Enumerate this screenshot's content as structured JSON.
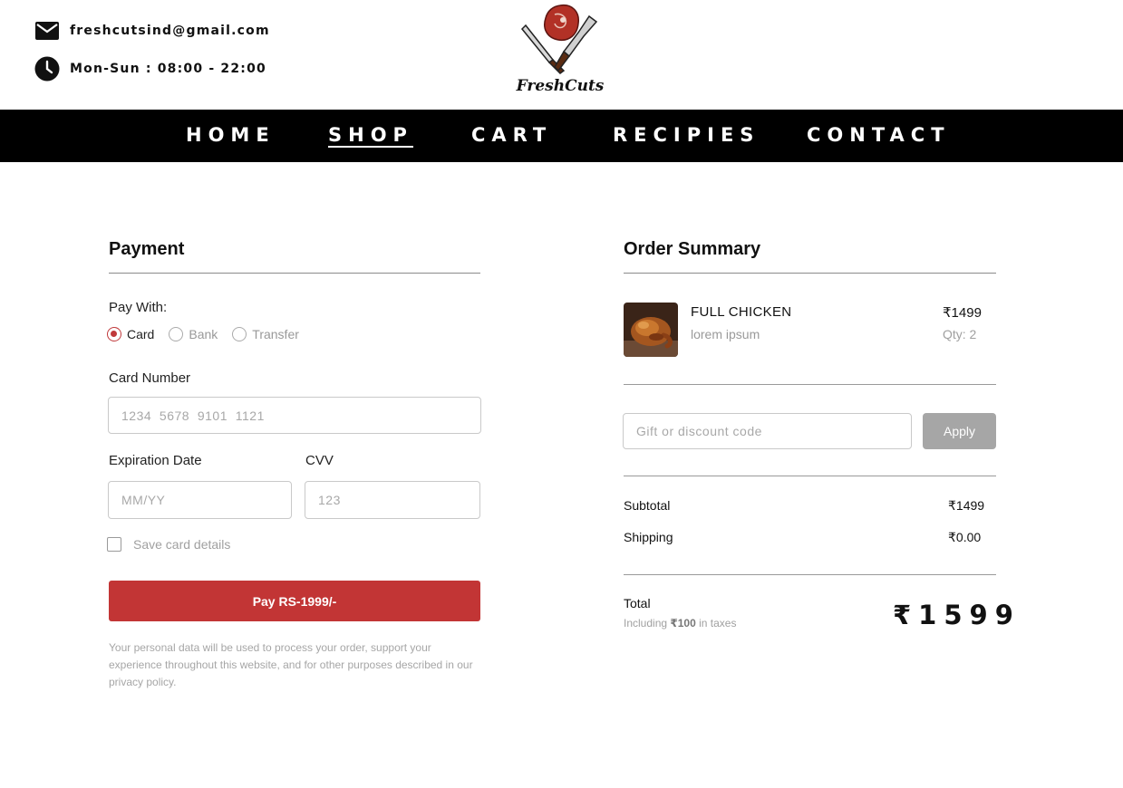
{
  "header": {
    "email": "freshcutsind@gmail.com",
    "hours": "Mon-Sun : 08:00 - 22:00",
    "logo_text": "FreshCuts",
    "icons": {
      "email": "mail-icon",
      "hours": "clock-icon"
    }
  },
  "nav": {
    "items": [
      {
        "label": "HOME"
      },
      {
        "label": "SHOP",
        "active": true
      },
      {
        "label": "CART"
      },
      {
        "label": "RECIPIES"
      },
      {
        "label": "CONTACT"
      }
    ]
  },
  "payment": {
    "title": "Payment",
    "pay_with_label": "Pay With:",
    "methods": [
      {
        "label": "Card",
        "selected": true
      },
      {
        "label": "Bank",
        "selected": false
      },
      {
        "label": "Transfer",
        "selected": false
      }
    ],
    "card_number_label": "Card Number",
    "card_number_placeholder": "1234  5678  9101  1121",
    "expiration_label": "Expiration Date",
    "expiration_placeholder": "MM/YY",
    "cvv_label": "CVV",
    "cvv_placeholder": "123",
    "save_card_label": "Save card details",
    "pay_button_label": "Pay  RS-1999/-",
    "privacy_text": "Your personal data will be used to process your order, support your experience throughout this website, and for other purposes described in our privacy policy."
  },
  "summary": {
    "title": "Order Summary",
    "item": {
      "name": "FULL CHICKEN",
      "description": "lorem ipsum",
      "price": "₹1499",
      "qty": "Qty: 2"
    },
    "discount_placeholder": "Gift or discount code",
    "apply_label": "Apply",
    "subtotal_label": "Subtotal",
    "subtotal_value": "₹1499",
    "shipping_label": "Shipping",
    "shipping_value": "₹0.00",
    "total_label": "Total",
    "total_note_prefix": "Including",
    "total_note_tax": "₹100",
    "total_note_suffix": "in taxes",
    "total_value": "₹1599"
  },
  "colors": {
    "accent": "#c23535",
    "nav_bg": "#000000",
    "muted": "#a6a6a6"
  }
}
